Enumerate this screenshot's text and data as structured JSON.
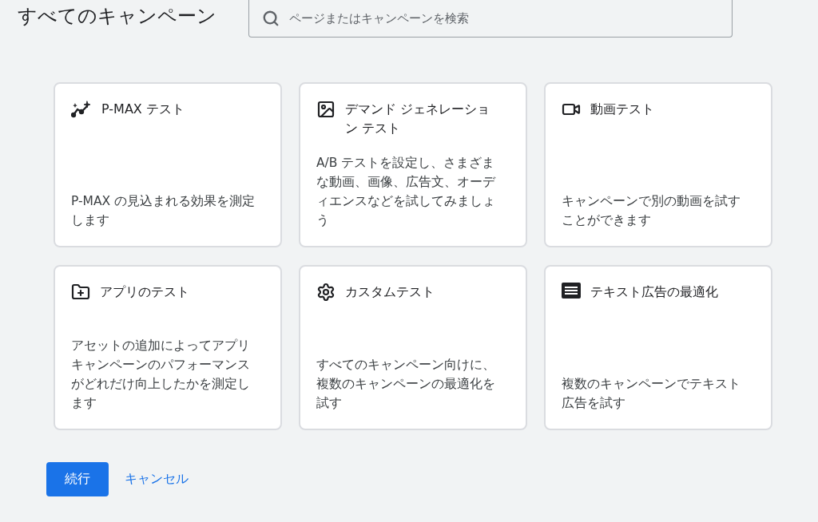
{
  "title": "すべてのキャンペーン",
  "search": {
    "placeholder": "ページまたはキャンペーンを検索"
  },
  "cards": [
    {
      "kind": "sparkline",
      "title": "P-MAX テスト",
      "description": "P-MAX の見込まれる効果を測定します"
    },
    {
      "kind": "image",
      "title": "デマンド ジェネレーション テスト",
      "description": "A/B テストを設定し、さまざまな動画、画像、広告文、オーディエンスなどを試してみましょう"
    },
    {
      "kind": "video",
      "title": "動画テスト",
      "description": "キャンペーンで別の動画を試すことができます"
    },
    {
      "kind": "folder",
      "title": "アプリのテスト",
      "description": "アセットの追加によってアプリキャンペーンのパフォーマンスがどれだけ向上したかを測定します"
    },
    {
      "kind": "gear",
      "title": "カスタムテスト",
      "description": "すべてのキャンペーン向けに、複数のキャンペーンの最適化を試す"
    },
    {
      "kind": "text",
      "title": "テキスト広告の最適化",
      "description": "複数のキャンペーンでテキスト広告を試す"
    }
  ],
  "actions": {
    "primary": "続行",
    "secondary": "キャンセル"
  }
}
